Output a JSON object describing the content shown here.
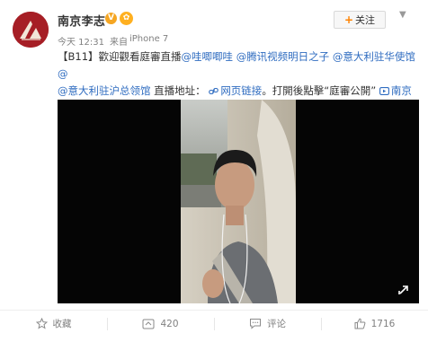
{
  "post": {
    "username": "南京李志",
    "verified_badge": "V",
    "follow_label": "关注",
    "timestamp": "今天 12:31",
    "source_prefix": "来自",
    "source": "iPhone 7",
    "text": {
      "part1": "【B11】歡迎觀看庭審直播",
      "mention1": "@哇唧唧哇",
      "space1": " ",
      "mention2": "@腾讯视频明日之子",
      "space2": " ",
      "mention3": "@意大利驻华使馆",
      "space3": " ",
      "mention4": "@意大利驻沪总领馆",
      "part2": " 直播地址：",
      "link_label": "网页链接",
      "part3": "。打開後點擊“庭審公開”",
      "link2_label": "南京李志的微博视频"
    }
  },
  "actions": {
    "favorite": "收藏",
    "repost": "420",
    "comment": "评论",
    "like": "1716"
  },
  "colors": {
    "accent": "#ff8200",
    "link": "#2f6cc0",
    "avatar_bg": "#a61e25"
  },
  "icons": {
    "favorite": "star-icon",
    "repost": "repost-icon",
    "comment": "comment-icon",
    "like": "thumbs-up-icon",
    "fullscreen": "fullscreen-icon",
    "link": "link-icon",
    "video_link": "video-icon"
  }
}
